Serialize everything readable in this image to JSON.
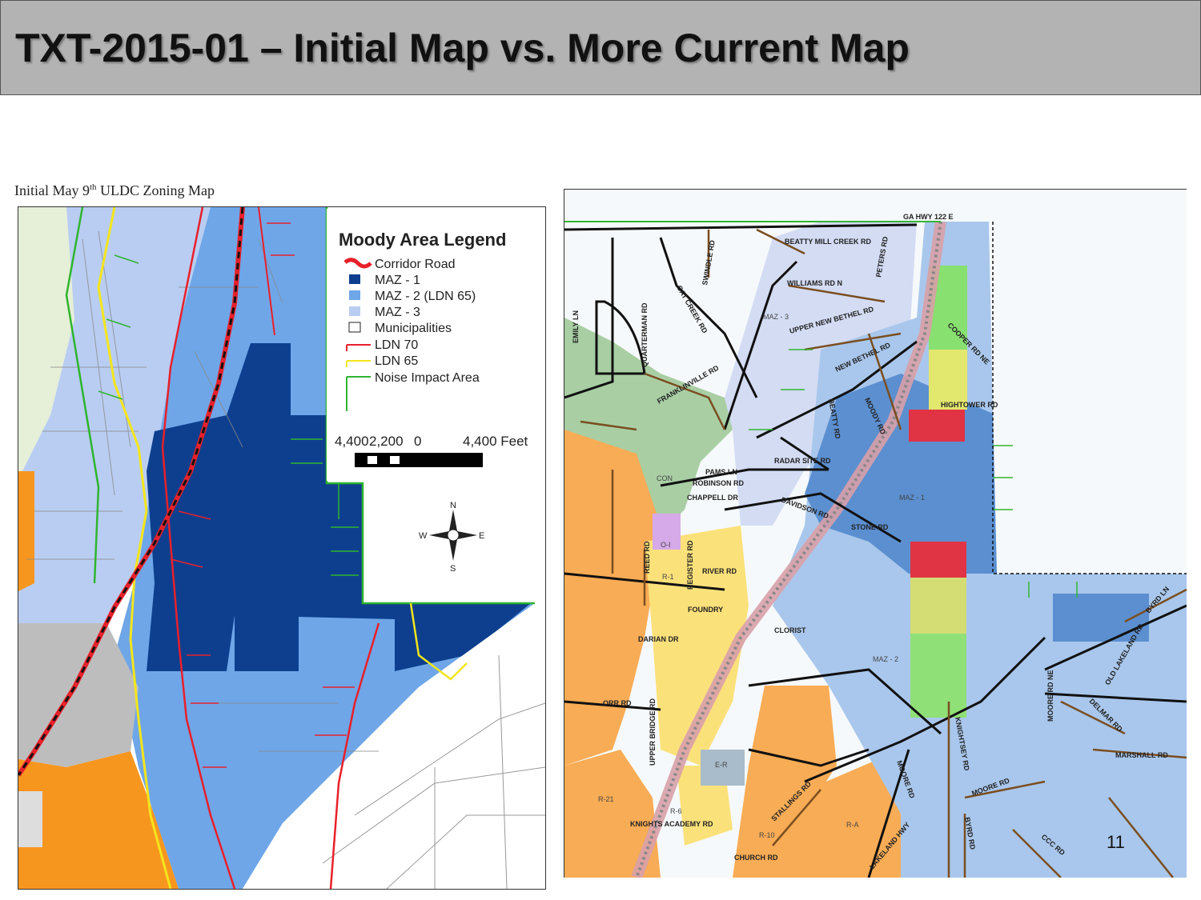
{
  "title": "TXT-2015-01 – Initial Map vs. More Current Map",
  "left_map": {
    "caption_prefix": "Initial May 9",
    "caption_sup": "th",
    "caption_suffix": " ULDC Zoning Map",
    "legend": {
      "title": "Moody Area Legend",
      "items": [
        {
          "label": "Corridor Road",
          "color": "#e8202a"
        },
        {
          "label": "MAZ - 1",
          "color": "#0e3f8f"
        },
        {
          "label": "MAZ - 2 (LDN 65)",
          "color": "#6fa6e8"
        },
        {
          "label": "MAZ - 3",
          "color": "#b9cdf2"
        },
        {
          "label": "Municipalities",
          "color": "#ffffff"
        },
        {
          "label": "LDN 70",
          "color": "#e8202a"
        },
        {
          "label": "LDN 65",
          "color": "#f3e51c"
        },
        {
          "label": "Noise Impact Area",
          "color": "#2fb52f"
        }
      ]
    },
    "scale": {
      "labels": [
        "4,400",
        "2,200",
        "0",
        "4,400 Feet"
      ]
    },
    "compass": {
      "n": "N",
      "s": "S",
      "e": "E",
      "w": "W"
    }
  },
  "right_map": {
    "roads": [
      "GA HWY 122 E",
      "BEATTY MILL CREEK RD",
      "WILLIAMS RD N",
      "PETERS RD",
      "NEW BETHEL RD",
      "UPPER NEW BETHEL RD",
      "COOPER RD NE",
      "HIGHTOWER RD",
      "SWINDLE RD",
      "CAT CREEK RD",
      "QUARTERMAN RD",
      "EMILY LN",
      "FRANKLINVILLE RD",
      "BEATTY RD",
      "MOODY RD",
      "RADAR SITE RD",
      "PAMS LN",
      "ROBINSON RD",
      "CHAPPELL DR",
      "DAVIDSON RD",
      "STONE RD",
      "REED RD",
      "REGISTER RD",
      "RIVER RD",
      "FOUNDRY",
      "DARIAN DR",
      "CLORIST",
      "ORR RD",
      "UPPER BRIDGE RD",
      "STALLINGS RD",
      "KNIGHTS ACADEMY RD",
      "CHURCH RD",
      "LAKELAND HWY",
      "MOORE RD",
      "KNIGHTSEY RD",
      "MOORE RD NE",
      "OLD LAKELAND RD",
      "BYRD LN",
      "DELMAR RD",
      "MARSHALL RD",
      "BYRD RD",
      "CCC RD",
      "MOORE RD"
    ],
    "zones": [
      "MAZ - 3",
      "MAZ - 1",
      "MAZ - 2",
      "CON",
      "O-I",
      "R-1",
      "R-21",
      "R-6",
      "E-R",
      "R-10",
      "R-A"
    ]
  },
  "page_number": "11"
}
